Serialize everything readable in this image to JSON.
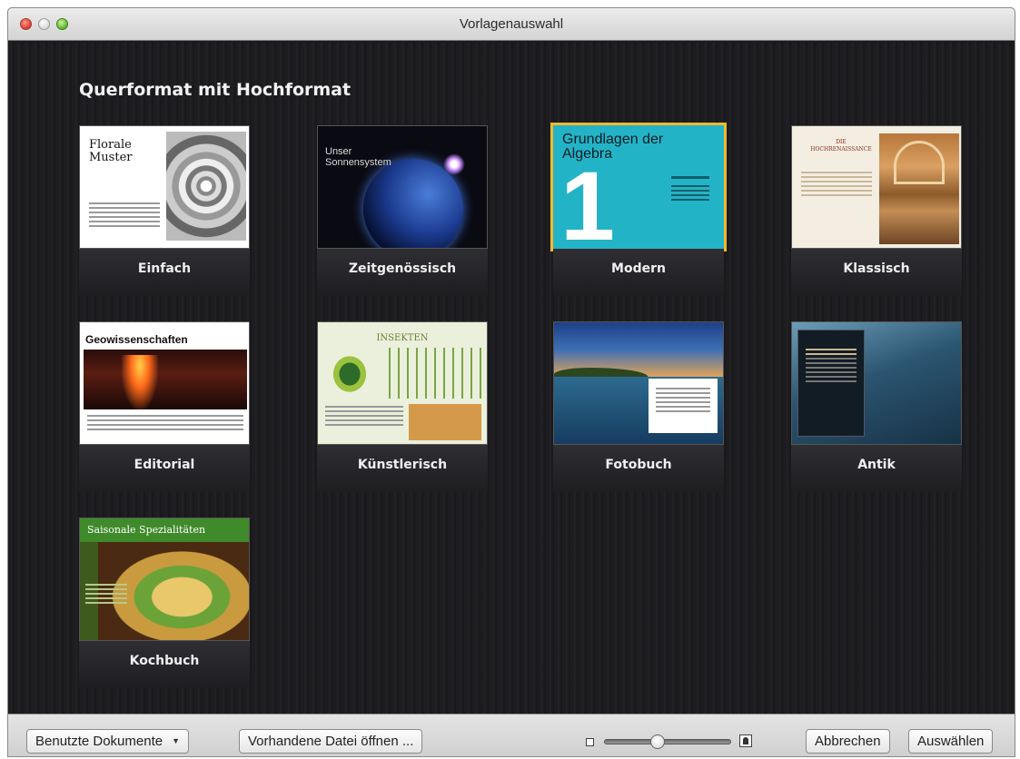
{
  "window": {
    "title": "Vorlagenauswahl"
  },
  "section": {
    "title": "Querformat mit Hochformat"
  },
  "templates": [
    {
      "label": "Einfach",
      "thumb_title": "Florale Muster",
      "selected": false
    },
    {
      "label": "Zeitgenössisch",
      "thumb_title": "Unser Sonnensystem",
      "selected": false
    },
    {
      "label": "Modern",
      "thumb_title": "Grundlagen der Algebra",
      "thumb_number": "1",
      "selected": true
    },
    {
      "label": "Klassisch",
      "thumb_title": "DIE HOCHRENAISSANCE",
      "selected": false
    },
    {
      "label": "Editorial",
      "thumb_title": "Geowissenschaften",
      "selected": false
    },
    {
      "label": "Künstlerisch",
      "thumb_title": "INSEKTEN",
      "selected": false
    },
    {
      "label": "Fotobuch",
      "selected": false
    },
    {
      "label": "Antik",
      "selected": false
    },
    {
      "label": "Kochbuch",
      "thumb_title": "Saisonale Spezialitäten",
      "selected": false
    }
  ],
  "bottombar": {
    "recent_label": "Benutzte Dokumente",
    "open_label": "Vorhandene Datei öffnen ...",
    "cancel_label": "Abbrechen",
    "choose_label": "Auswählen",
    "zoom_level": 0.4
  },
  "colors": {
    "selection": "#f2b92b",
    "background": "#1b1b1e",
    "modern_cyan": "#23b3c7"
  }
}
